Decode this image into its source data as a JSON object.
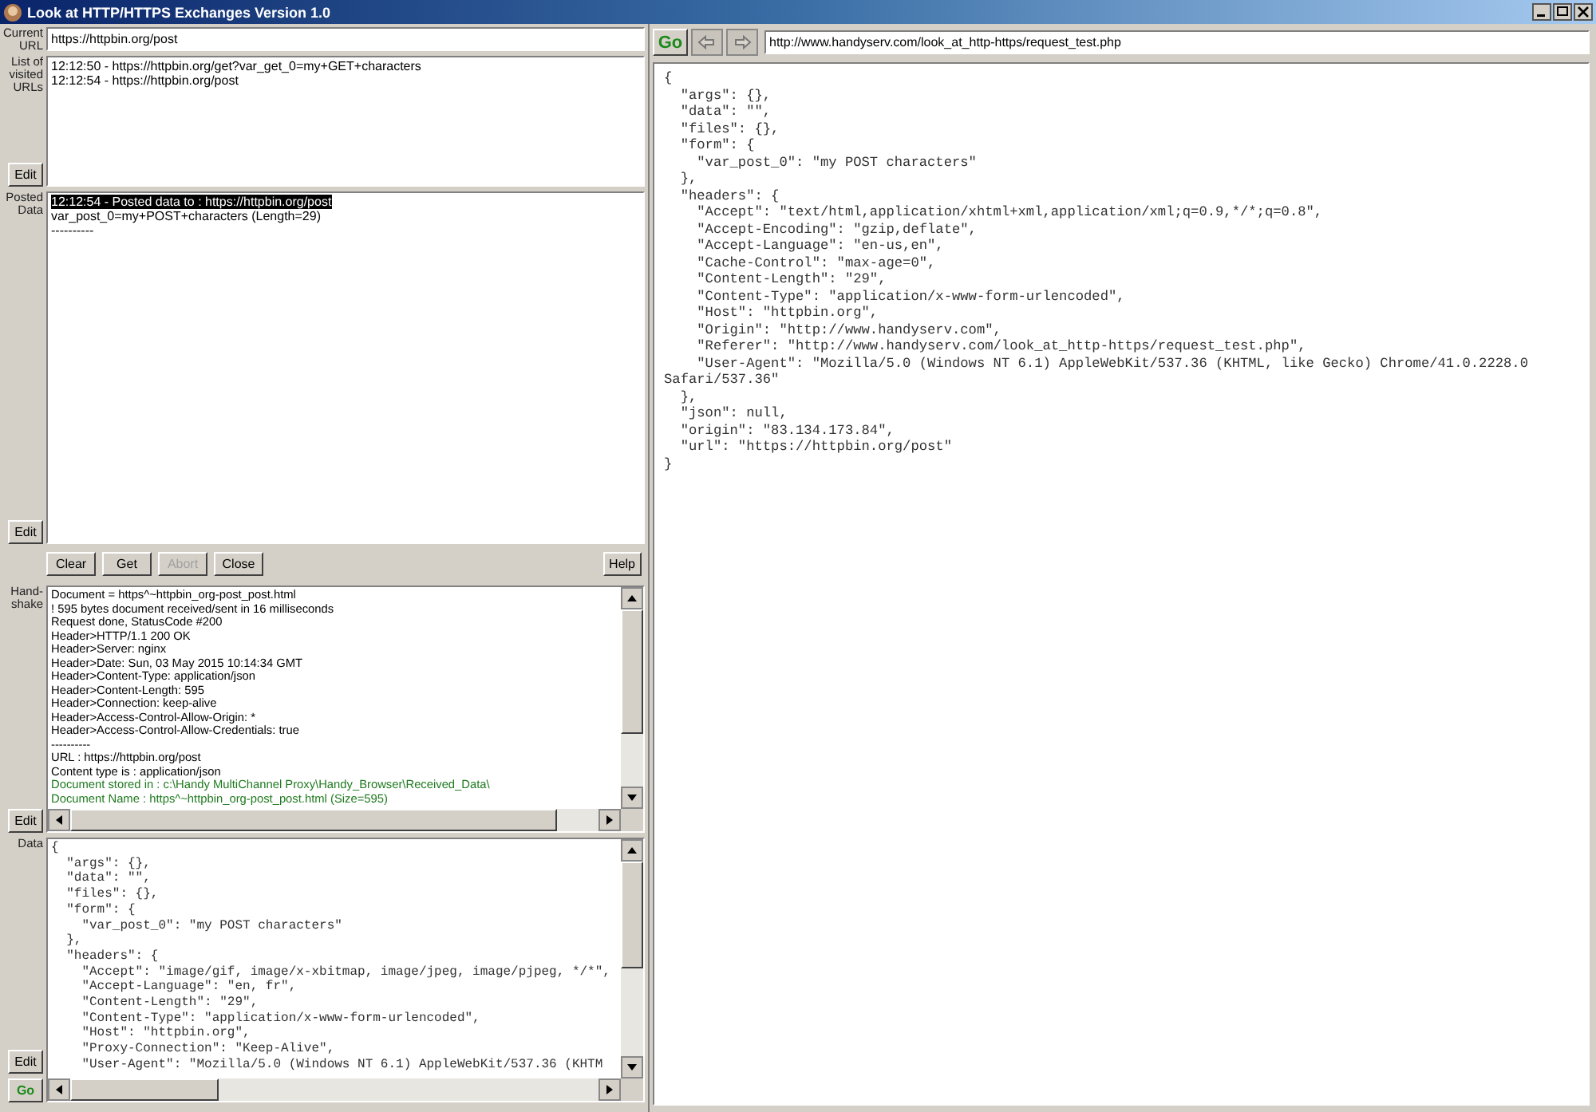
{
  "window": {
    "title": "Look at HTTP/HTTPS Exchanges Version 1.0"
  },
  "current_url": {
    "label": "Current URL",
    "value": "https://httpbin.org/post"
  },
  "visited_urls": {
    "label": "List of visited URLs",
    "edit_button": "Edit",
    "items": [
      {
        "text": "12:12:50 - https://httpbin.org/get?var_get_0=my+GET+characters",
        "selected": false
      },
      {
        "text": "12:12:54 - https://httpbin.org/post",
        "selected": false
      }
    ]
  },
  "posted_data": {
    "label": "Posted Data",
    "edit_button": "Edit",
    "lines": [
      {
        "text": "12:12:54 - Posted data to : https://httpbin.org/post",
        "selected": true
      },
      {
        "text": "var_post_0=my+POST+characters (Length=29)",
        "selected": false
      },
      {
        "text": "----------",
        "selected": false
      }
    ]
  },
  "buttons": [
    {
      "label": "Clear",
      "disabled": false
    },
    {
      "label": "Get",
      "disabled": false
    },
    {
      "label": "Abort",
      "disabled": true
    },
    {
      "label": "Close",
      "disabled": false
    }
  ],
  "help_button": "Help",
  "handshake": {
    "label": "Hand-shake",
    "edit_button": "Edit",
    "lines": [
      {
        "text": "Document = https^~httpbin_org-post_post.html",
        "kind": "info"
      },
      {
        "text": "! 595 bytes document received/sent in 16 milliseconds",
        "kind": "info"
      },
      {
        "text": "Request done, StatusCode #200",
        "kind": "info"
      },
      {
        "text": "Header>HTTP/1.1 200 OK",
        "kind": "info"
      },
      {
        "text": "Header>Server: nginx",
        "kind": "info"
      },
      {
        "text": "Header>Date: Sun, 03 May 2015 10:14:34 GMT",
        "kind": "info"
      },
      {
        "text": "Header>Content-Type: application/json",
        "kind": "info"
      },
      {
        "text": "Header>Content-Length: 595",
        "kind": "info"
      },
      {
        "text": "Header>Connection: keep-alive",
        "kind": "info"
      },
      {
        "text": "Header>Access-Control-Allow-Origin: *",
        "kind": "info"
      },
      {
        "text": "Header>Access-Control-Allow-Credentials: true",
        "kind": "info"
      },
      {
        "text": "----------",
        "kind": "info"
      },
      {
        "text": "URL : https://httpbin.org/post",
        "kind": "info"
      },
      {
        "text": "Content type is : application/json",
        "kind": "info"
      },
      {
        "text": "Document stored in : c:\\Handy MultiChannel Proxy\\Handy_Browser\\Received_Data\\",
        "kind": "stored"
      },
      {
        "text": "Document Name : https^~httpbin_org-post_post.html (Size=595)",
        "kind": "stored"
      }
    ]
  },
  "data": {
    "label": "Data",
    "edit_button": "Edit",
    "go_button": "Go",
    "lines": [
      "{",
      "  \"args\": {},",
      "  \"data\": \"\",",
      "  \"files\": {},",
      "  \"form\": {",
      "    \"var_post_0\": \"my POST characters\"",
      "  },",
      "  \"headers\": {",
      "    \"Accept\": \"image/gif, image/x-xbitmap, image/jpeg, image/pjpeg, */*\",",
      "    \"Accept-Language\": \"en, fr\",",
      "    \"Content-Length\": \"29\",",
      "    \"Content-Type\": \"application/x-www-form-urlencoded\",",
      "    \"Host\": \"httpbin.org\",",
      "    \"Proxy-Connection\": \"Keep-Alive\",",
      "    \"User-Agent\": \"Mozilla/5.0 (Windows NT 6.1) AppleWebKit/537.36 (KHTM"
    ]
  },
  "browser": {
    "go_button": "Go",
    "address": "http://www.handyserv.com/look_at_http-https/request_test.php",
    "lines": [
      "{",
      "  \"args\": {},",
      "  \"data\": \"\",",
      "  \"files\": {},",
      "  \"form\": {",
      "    \"var_post_0\": \"my POST characters\"",
      "  },",
      "  \"headers\": {",
      "    \"Accept\": \"text/html,application/xhtml+xml,application/xml;q=0.9,*/*;q=0.8\",",
      "    \"Accept-Encoding\": \"gzip,deflate\",",
      "    \"Accept-Language\": \"en-us,en\",",
      "    \"Cache-Control\": \"max-age=0\",",
      "    \"Content-Length\": \"29\",",
      "    \"Content-Type\": \"application/x-www-form-urlencoded\",",
      "    \"Host\": \"httpbin.org\",",
      "    \"Origin\": \"http://www.handyserv.com\",",
      "    \"Referer\": \"http://www.handyserv.com/look_at_http-https/request_test.php\",",
      "    \"User-Agent\": \"Mozilla/5.0 (Windows NT 6.1) AppleWebKit/537.36 (KHTML, like Gecko) Chrome/41.0.2228.0",
      "Safari/537.36\"",
      "  },",
      "  \"json\": null,",
      "  \"origin\": \"83.134.173.84\",",
      "  \"url\": \"https://httpbin.org/post\"",
      "}"
    ]
  }
}
